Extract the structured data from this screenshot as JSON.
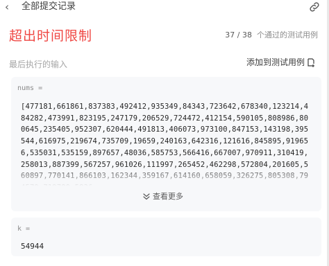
{
  "header": {
    "back_glyph": "‹",
    "title": "全部提交记录",
    "link_icon": "link-icon"
  },
  "result": {
    "status": "超出时间限制",
    "passed": "37 / 38",
    "passed_suffix": "个通过的测试用例"
  },
  "last_input": {
    "label": "最后执行的输入",
    "add_case_label": "添加到测试用例"
  },
  "inputs": [
    {
      "name": "nums =",
      "value": "[477181,661861,837383,492412,935349,84343,723642,678340,123214,484282,473991,823195,247179,206529,724472,412154,590105,808986,800645,235405,952307,620444,491813,406073,973100,847153,143198,395544,616975,219674,735709,19659,240163,642316,121616,845895,919656,535031,535159,897657,48036,585753,566416,667007,970911,310419,258013,887399,567257,961026,111997,265452,462298,572804,201605,560897,770141,866103,162344,359167,614160,658059,326275,805308,794579,719789,5836",
      "more_label": "查看更多"
    },
    {
      "name": "k =",
      "value": "54944"
    }
  ],
  "colors": {
    "status": "#ef4743",
    "card_bg": "#f7f8fa"
  }
}
